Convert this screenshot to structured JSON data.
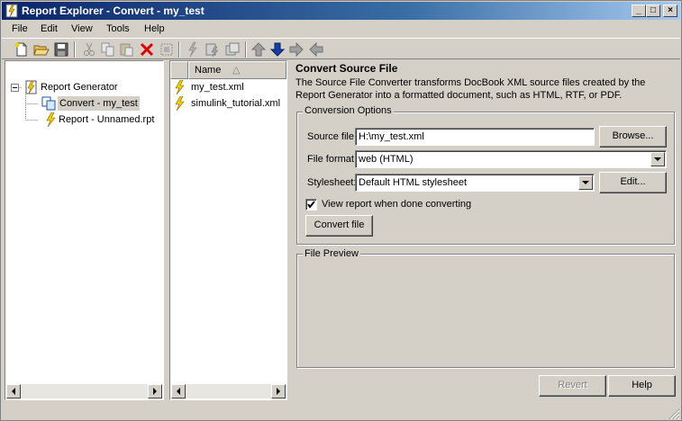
{
  "window": {
    "title": "Report Explorer - Convert - my_test",
    "minimize": "_",
    "maximize": "□",
    "close": "×"
  },
  "menu": [
    "File",
    "Edit",
    "View",
    "Tools",
    "Help"
  ],
  "toolbar_icons": [
    "new-icon",
    "open-icon",
    "save-icon",
    "cut-icon",
    "copy-icon",
    "paste-icon",
    "delete-icon",
    "properties-icon",
    "run-report-icon",
    "run-all-icon",
    "run-icon",
    "move-up-icon",
    "move-down-icon",
    "demote-icon",
    "promote-icon"
  ],
  "tree": {
    "root": "Report Generator",
    "items": [
      {
        "label": "Convert - my_test",
        "selected": true
      },
      {
        "label": "Report - Unnamed.rpt",
        "selected": false
      }
    ]
  },
  "filelist": {
    "column_header": "Name",
    "sort_indicator": "△",
    "files": [
      "my_test.xml",
      "simulink_tutorial.xml"
    ]
  },
  "main": {
    "heading": "Convert Source File",
    "description": "The Source File Converter transforms DocBook XML source files created by the Report Generator into a formatted document, such as HTML, RTF, or PDF.",
    "conversion_options": {
      "group_label": "Conversion Options",
      "source_file_label": "Source file:",
      "source_file_value": "H:\\my_test.xml",
      "browse_button": "Browse...",
      "file_format_label": "File format:",
      "file_format_value": "web (HTML)",
      "stylesheet_label": "Stylesheet:",
      "stylesheet_value": "Default HTML stylesheet",
      "edit_button": "Edit...",
      "view_report_label": "View report when done converting",
      "view_report_checked": true,
      "convert_button": "Convert file"
    },
    "file_preview_label": "File Preview",
    "revert_button": "Revert",
    "help_button": "Help"
  }
}
